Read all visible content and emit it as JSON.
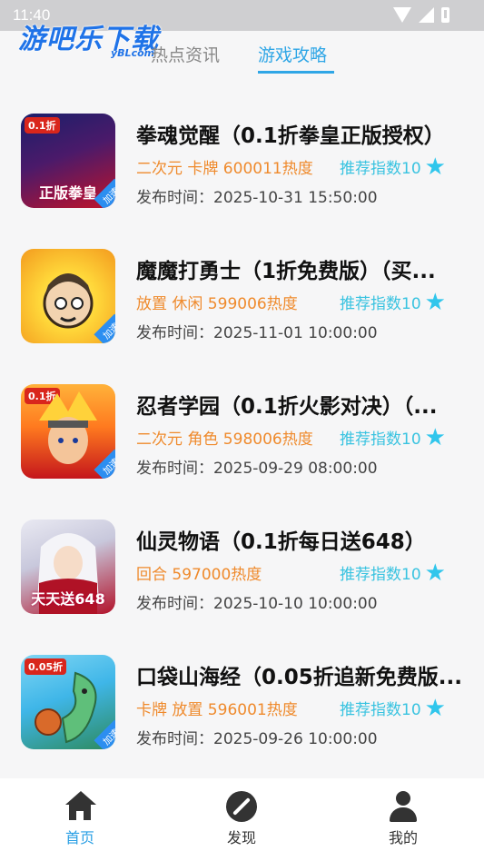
{
  "status_bar": {
    "time": "11:40"
  },
  "watermark": {
    "logo_text": "游吧乐下载",
    "logo_sub": "yBLcom"
  },
  "tabs": [
    {
      "label": "热点资讯",
      "active": false
    },
    {
      "label": "游戏攻略",
      "active": true
    }
  ],
  "accent_color": "#2fa6e6",
  "tag_color": "#ef8a2c",
  "items": [
    {
      "title": "拳魂觉醒（0.1折拳皇正版授权）",
      "tags": "二次元 卡牌 600011热度",
      "recommend": "推荐指数10",
      "date": "发布时间：2025-10-31 15:50:00",
      "thumb": {
        "corner": "0.1折",
        "big": "正版拳皇",
        "speed": "加速",
        "colors": [
          "#1a1f6b",
          "#c0132a"
        ]
      }
    },
    {
      "title": "魔魔打勇士（1折免费版）（买...",
      "tags": "放置 休闲 599006热度",
      "recommend": "推荐指数10",
      "date": "发布时间：2025-11-01 10:00:00",
      "thumb": {
        "corner": "",
        "big": "",
        "speed": "加速",
        "colors": [
          "#ffd83a",
          "#f39a1e"
        ]
      }
    },
    {
      "title": "忍者学园（0.1折火影对决）（...",
      "tags": "二次元 角色 598006热度",
      "recommend": "推荐指数10",
      "date": "发布时间：2025-09-29 08:00:00",
      "thumb": {
        "corner": "0.1折",
        "big": "",
        "speed": "加速",
        "colors": [
          "#ff8a1f",
          "#c4161c"
        ]
      }
    },
    {
      "title": "仙灵物语（0.1折每日送648）",
      "tags": "回合 597000热度",
      "recommend": "推荐指数10",
      "date": "发布时间：2025-10-10 10:00:00",
      "thumb": {
        "corner": "",
        "big": "天天送648",
        "speed": "",
        "colors": [
          "#d7d7e6",
          "#b2122a"
        ]
      }
    },
    {
      "title": "口袋山海经（0.05折追新免费版...",
      "tags": "卡牌 放置 596001热度",
      "recommend": "推荐指数10",
      "date": "发布时间：2025-09-26 10:00:00",
      "thumb": {
        "corner": "0.05折",
        "big": "",
        "speed": "加速",
        "colors": [
          "#3fb6e8",
          "#2d8a5e"
        ]
      }
    }
  ],
  "bottom_nav": [
    {
      "label": "首页",
      "icon": "home-icon",
      "active": true
    },
    {
      "label": "发现",
      "icon": "compass-icon",
      "active": false
    },
    {
      "label": "我的",
      "icon": "user-icon",
      "active": false
    }
  ]
}
